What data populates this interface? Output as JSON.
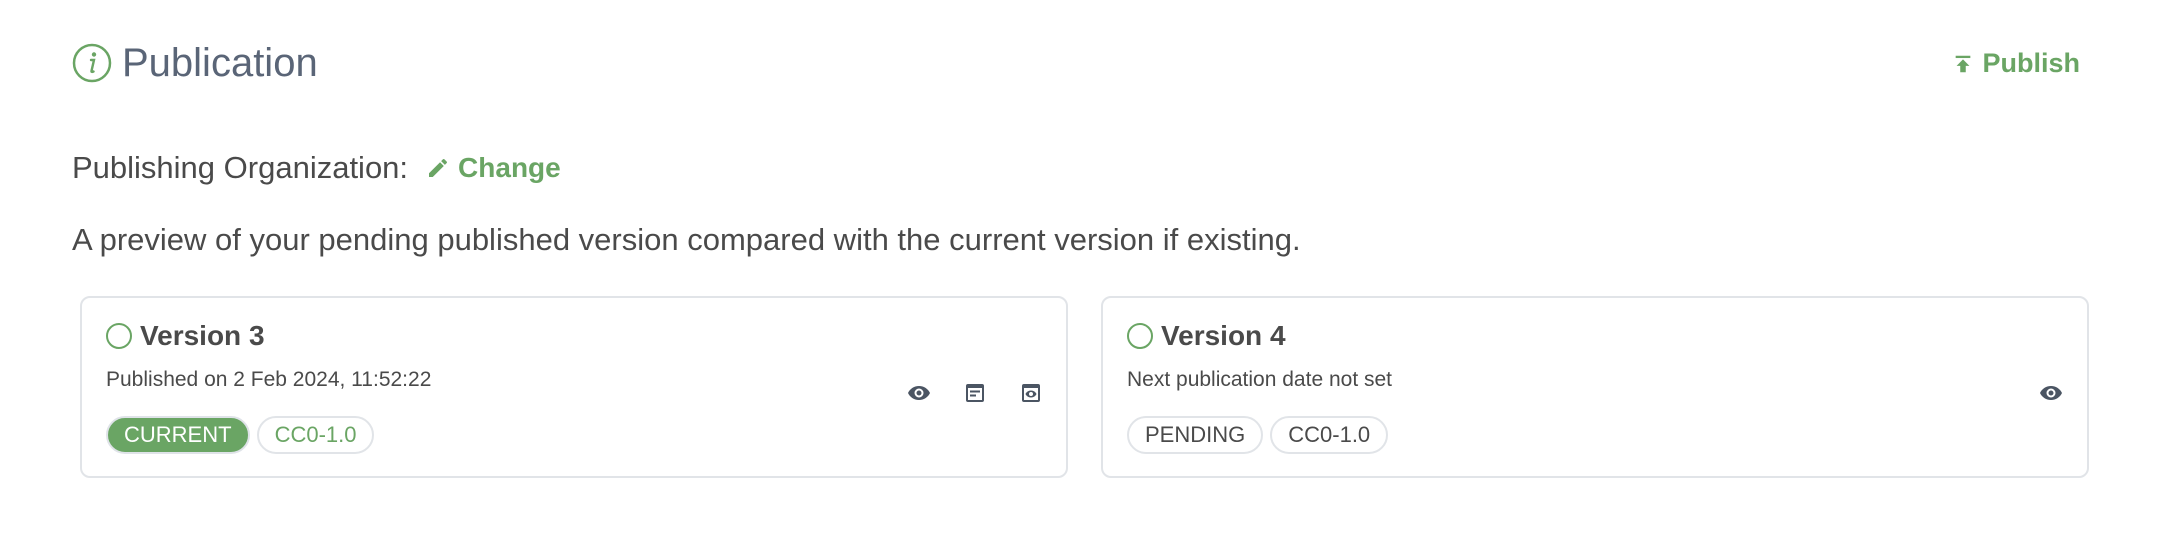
{
  "header": {
    "title": "Publication",
    "info_icon": "info-circle-icon",
    "publish_label": "Publish",
    "publish_icon": "upload-arrow-icon"
  },
  "organization": {
    "label": "Publishing Organization:",
    "change_label": "Change",
    "change_icon": "pencil-icon"
  },
  "description": "A preview of your pending published version compared with the current version if existing.",
  "colors": {
    "accent": "#6aa564",
    "title": "#5a6577",
    "text": "#4a4a4a",
    "border": "#e1e4e8",
    "icon": "#4b5563"
  },
  "versions": [
    {
      "name": "Version 3",
      "subtitle": "Published on 2 Feb 2024, 11:52:22",
      "status": "CURRENT",
      "license": "CC0-1.0",
      "actions": [
        "eye-icon",
        "document-icon",
        "preview-icon"
      ]
    },
    {
      "name": "Version 4",
      "subtitle": "Next publication date not set",
      "status": "PENDING",
      "license": "CC0-1.0",
      "actions": [
        "eye-icon"
      ]
    }
  ]
}
